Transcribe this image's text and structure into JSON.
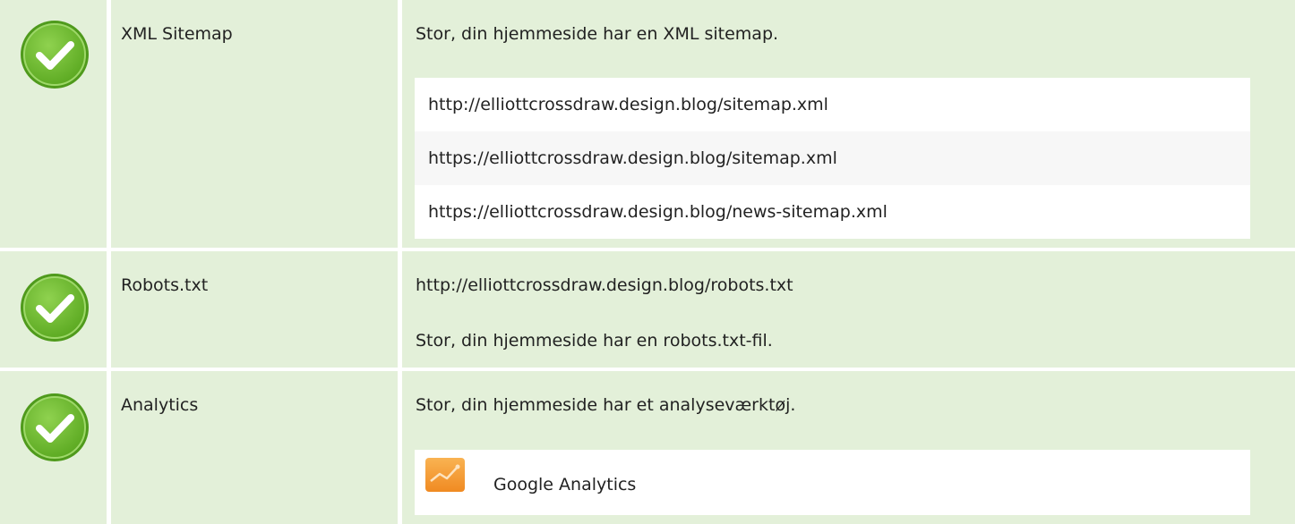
{
  "checks": [
    {
      "title": "XML Sitemap",
      "message": "Stor, din hjemmeside har en XML sitemap.",
      "urls": [
        "http://elliottcrossdraw.design.blog/sitemap.xml",
        "https://elliottcrossdraw.design.blog/sitemap.xml",
        "https://elliottcrossdraw.design.blog/news-sitemap.xml"
      ]
    },
    {
      "title": "Robots.txt",
      "url": "http://elliottcrossdraw.design.blog/robots.txt",
      "message": "Stor, din hjemmeside har en robots.txt-fil."
    },
    {
      "title": "Analytics",
      "message": "Stor, din hjemmeside har et analyseværktøj.",
      "tool_name": "Google Analytics"
    }
  ],
  "colors": {
    "row_background": "#e3f0d9",
    "check_green": "#6cbf2f",
    "check_border": "#4f9a1c",
    "analytics_orange": "#f59a34"
  },
  "icons": {
    "status": "check-circle-icon",
    "tool": "google-analytics-logo-icon"
  }
}
